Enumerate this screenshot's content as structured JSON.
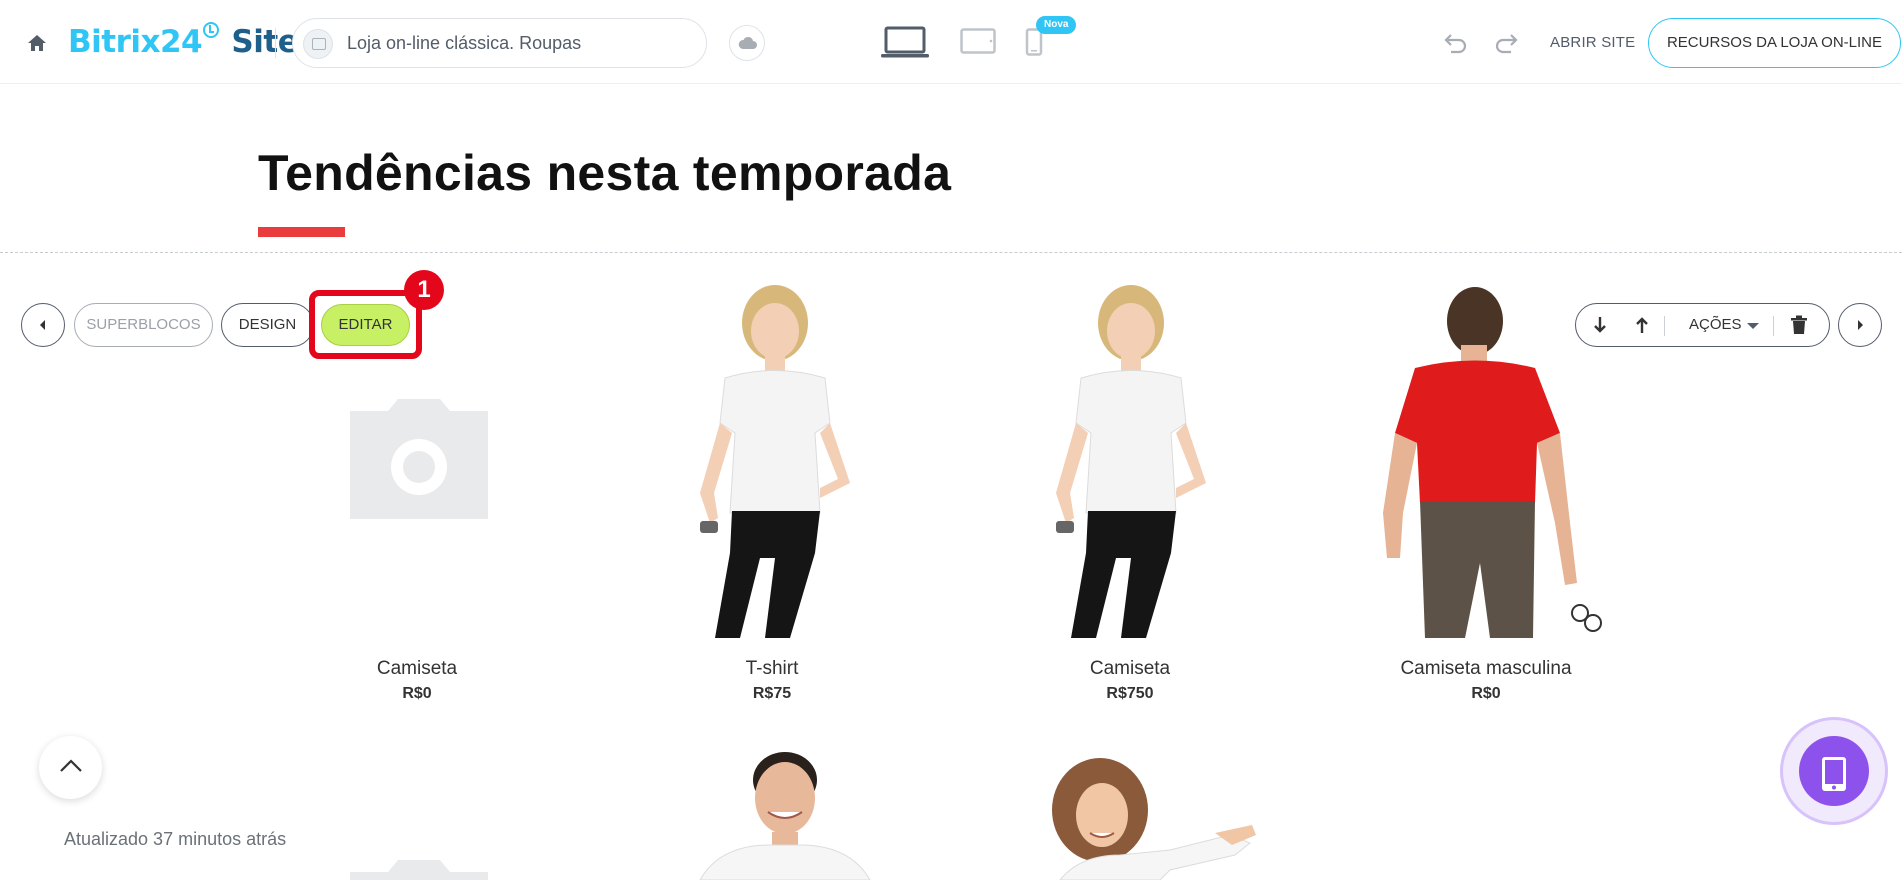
{
  "header": {
    "logo_main": "Bitrix24",
    "logo_sites": "Sites",
    "site_name": "Loja on-line clássica. Roupas",
    "new_badge": "Nova",
    "open_site": "ABRIR SITE",
    "resources": "RECURSOS DA LOJA ON-LINE",
    "brand_color": "#2fc6f6"
  },
  "block": {
    "title": "Tendências nesta temporada",
    "accent_color": "#ea3c3c"
  },
  "toolbar": {
    "superblocks": "SUPERBLOCOS",
    "design": "DESIGN",
    "edit": "EDITAR",
    "edit_color": "#c7f064",
    "highlight_number": "1",
    "actions": "AÇÕES"
  },
  "products": [
    {
      "name": "Camiseta",
      "price": "R$0",
      "image": "placeholder-camera"
    },
    {
      "name": "T-shirt",
      "price": "R$75",
      "image": "woman-white-tshirt"
    },
    {
      "name": "Camiseta",
      "price": "R$750",
      "image": "woman-white-tshirt"
    },
    {
      "name": "Camiseta masculina",
      "price": "R$0",
      "image": "man-red-tshirt-back"
    }
  ],
  "second_row": [
    {
      "image": "placeholder-camera"
    },
    {
      "image": "man-white-tshirt-smiling"
    },
    {
      "image": "woman-pointing"
    }
  ],
  "footer": {
    "updated": "Atualizado 37 minutos atrás"
  }
}
